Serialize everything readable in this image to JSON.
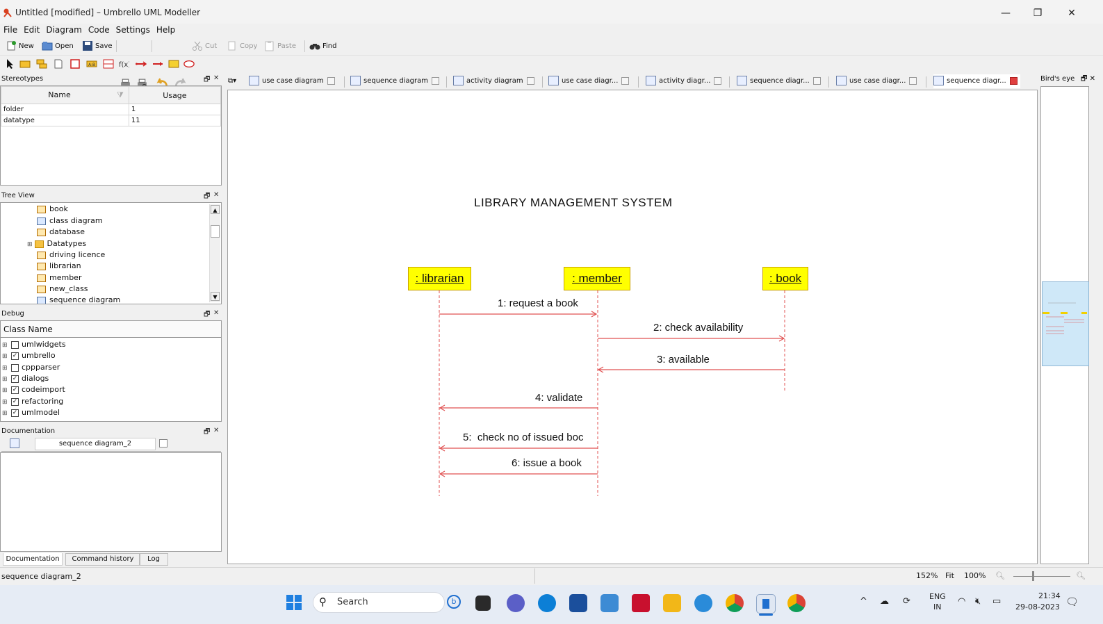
{
  "window": {
    "title": "Untitled [modified] – Umbrello UML Modeller",
    "controls": [
      "—",
      "❐",
      "✕"
    ]
  },
  "menu": [
    "File",
    "Edit",
    "Diagram",
    "Code",
    "Settings",
    "Help"
  ],
  "toolbar": {
    "new": "New",
    "open": "Open",
    "save": "Save",
    "cut": "Cut",
    "copy": "Copy",
    "paste": "Paste",
    "find": "Find"
  },
  "stereotypes": {
    "title": "Stereotypes",
    "col_name": "Name",
    "col_usage": "Usage",
    "rows": [
      {
        "name": "folder",
        "usage": "1"
      },
      {
        "name": "datatype",
        "usage": "11"
      }
    ]
  },
  "tree_view": {
    "title": "Tree View",
    "items": [
      "book",
      "class diagram",
      "database",
      "Datatypes",
      "driving licence",
      "librarian",
      "member",
      "new_class",
      "sequence diagram"
    ]
  },
  "debug": {
    "title": "Debug",
    "header": "Class Name",
    "items": [
      {
        "name": "umlwidgets",
        "checked": false
      },
      {
        "name": "umbrello",
        "checked": true
      },
      {
        "name": "cppparser",
        "checked": false
      },
      {
        "name": "dialogs",
        "checked": true
      },
      {
        "name": "codeimport",
        "checked": true
      },
      {
        "name": "refactoring",
        "checked": true
      },
      {
        "name": "umlmodel",
        "checked": true
      }
    ]
  },
  "documentation": {
    "title": "Documentation",
    "diagram_name": "sequence diagram_2",
    "tabs": [
      "Documentation",
      "Command history",
      "Log"
    ]
  },
  "tabs": [
    "use case diagram",
    "sequence diagram",
    "activity diagram",
    "use case diagr...",
    "activity diagr...",
    "sequence diagr...",
    "use case diagr...",
    "sequence diagr..."
  ],
  "diagram": {
    "title": "LIBRARY MANAGEMENT SYSTEM",
    "objects": [
      ": librarian",
      ": member",
      ": book"
    ],
    "messages": [
      "1: request a book",
      "2: check availability",
      "3: available",
      "4: validate",
      "5:  check no of issued boc",
      "6: issue a book"
    ]
  },
  "birdseye": {
    "title": "Bird's eye"
  },
  "status": {
    "text": "sequence diagram_2",
    "zoom": "152%",
    "fit": "Fit",
    "reset": "100%"
  },
  "taskbar": {
    "search": "Search",
    "lang": "ENG",
    "region": "IN",
    "time": "21:34",
    "date": "29-08-2023"
  },
  "colors": {
    "message_line": "#e05050",
    "lifeline": "#e05050",
    "object_fill": "#ffff00",
    "bird_view": "#cfe8f8"
  }
}
